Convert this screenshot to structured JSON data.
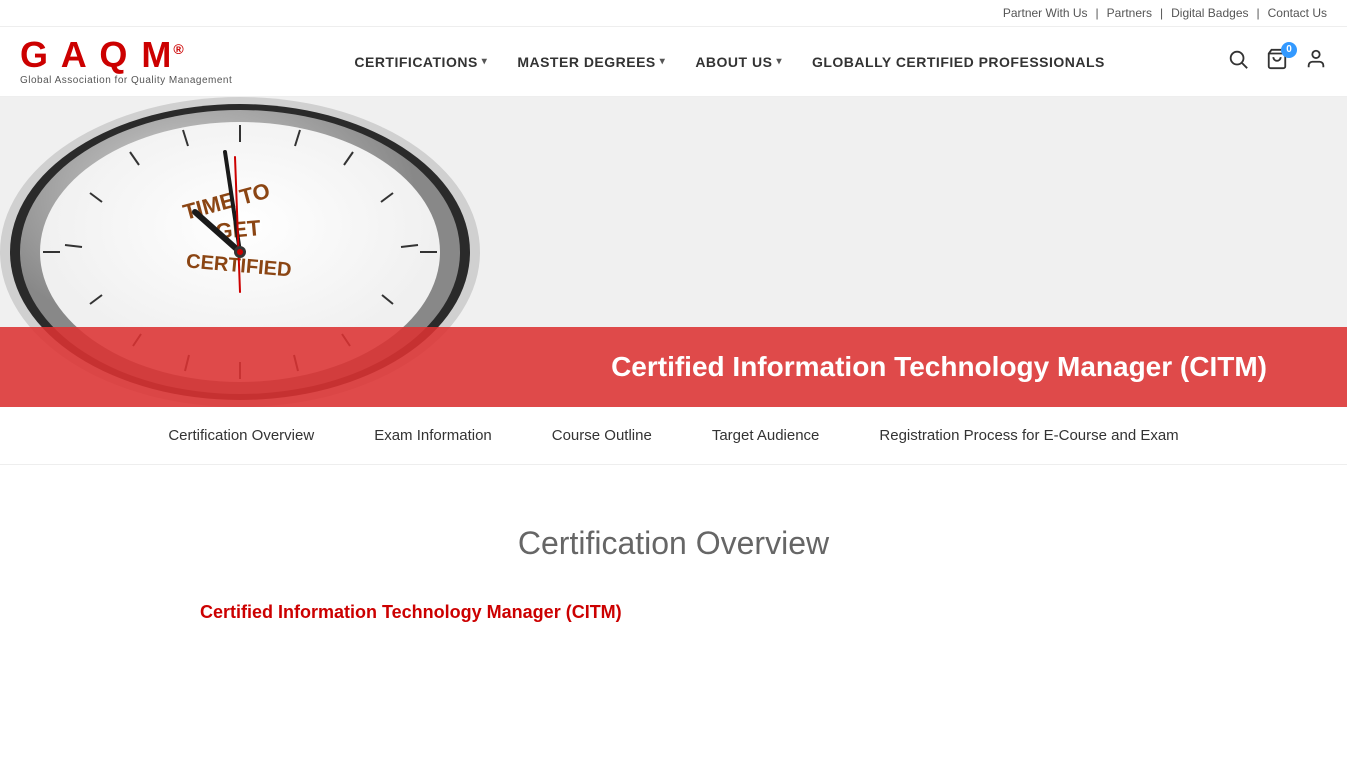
{
  "utility": {
    "partner": "Partner With Us",
    "sep1": "|",
    "partners": "Partners",
    "sep2": "|",
    "digital_badges": "Digital Badges",
    "sep3": "|",
    "contact_us": "Contact Us"
  },
  "logo": {
    "text": "GAQM",
    "registered": "®",
    "subtitle": "Global Association for Quality Management"
  },
  "nav": {
    "items": [
      {
        "label": "CERTIFICATIONS",
        "has_dropdown": true
      },
      {
        "label": "MASTER DEGREES",
        "has_dropdown": true
      },
      {
        "label": "ABOUT US",
        "has_dropdown": true
      },
      {
        "label": "GLOBALLY CERTIFIED PROFESSIONALS",
        "has_dropdown": false
      }
    ]
  },
  "cart": {
    "count": "0"
  },
  "hero": {
    "title": "Certified Information Technology Manager (CITM)"
  },
  "tabs": [
    {
      "label": "Certification Overview"
    },
    {
      "label": "Exam Information"
    },
    {
      "label": "Course Outline"
    },
    {
      "label": "Target Audience"
    },
    {
      "label": "Registration Process for E-Course and Exam"
    }
  ],
  "content": {
    "section_title": "Certification Overview",
    "cert_name": "Certified Information Technology Manager (CITM)"
  }
}
